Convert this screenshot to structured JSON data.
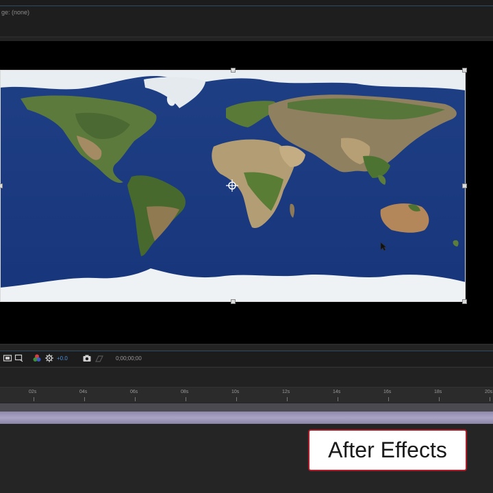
{
  "header": {
    "text": "ge: (none)"
  },
  "toolbar": {
    "exposure": "+0.0",
    "timecode": "0;00;00;00"
  },
  "ruler": {
    "ticks": [
      "02s",
      "04s",
      "06s",
      "08s",
      "10s",
      "12s",
      "14s",
      "16s",
      "18s",
      "20s"
    ]
  },
  "brand": {
    "label": "After Effects"
  },
  "colors": {
    "panel": "#232323",
    "viewer": "#000000",
    "accent_blue": "#4f8ed6",
    "work_area": "#a9a4c6",
    "badge_border": "#b01d2a"
  }
}
